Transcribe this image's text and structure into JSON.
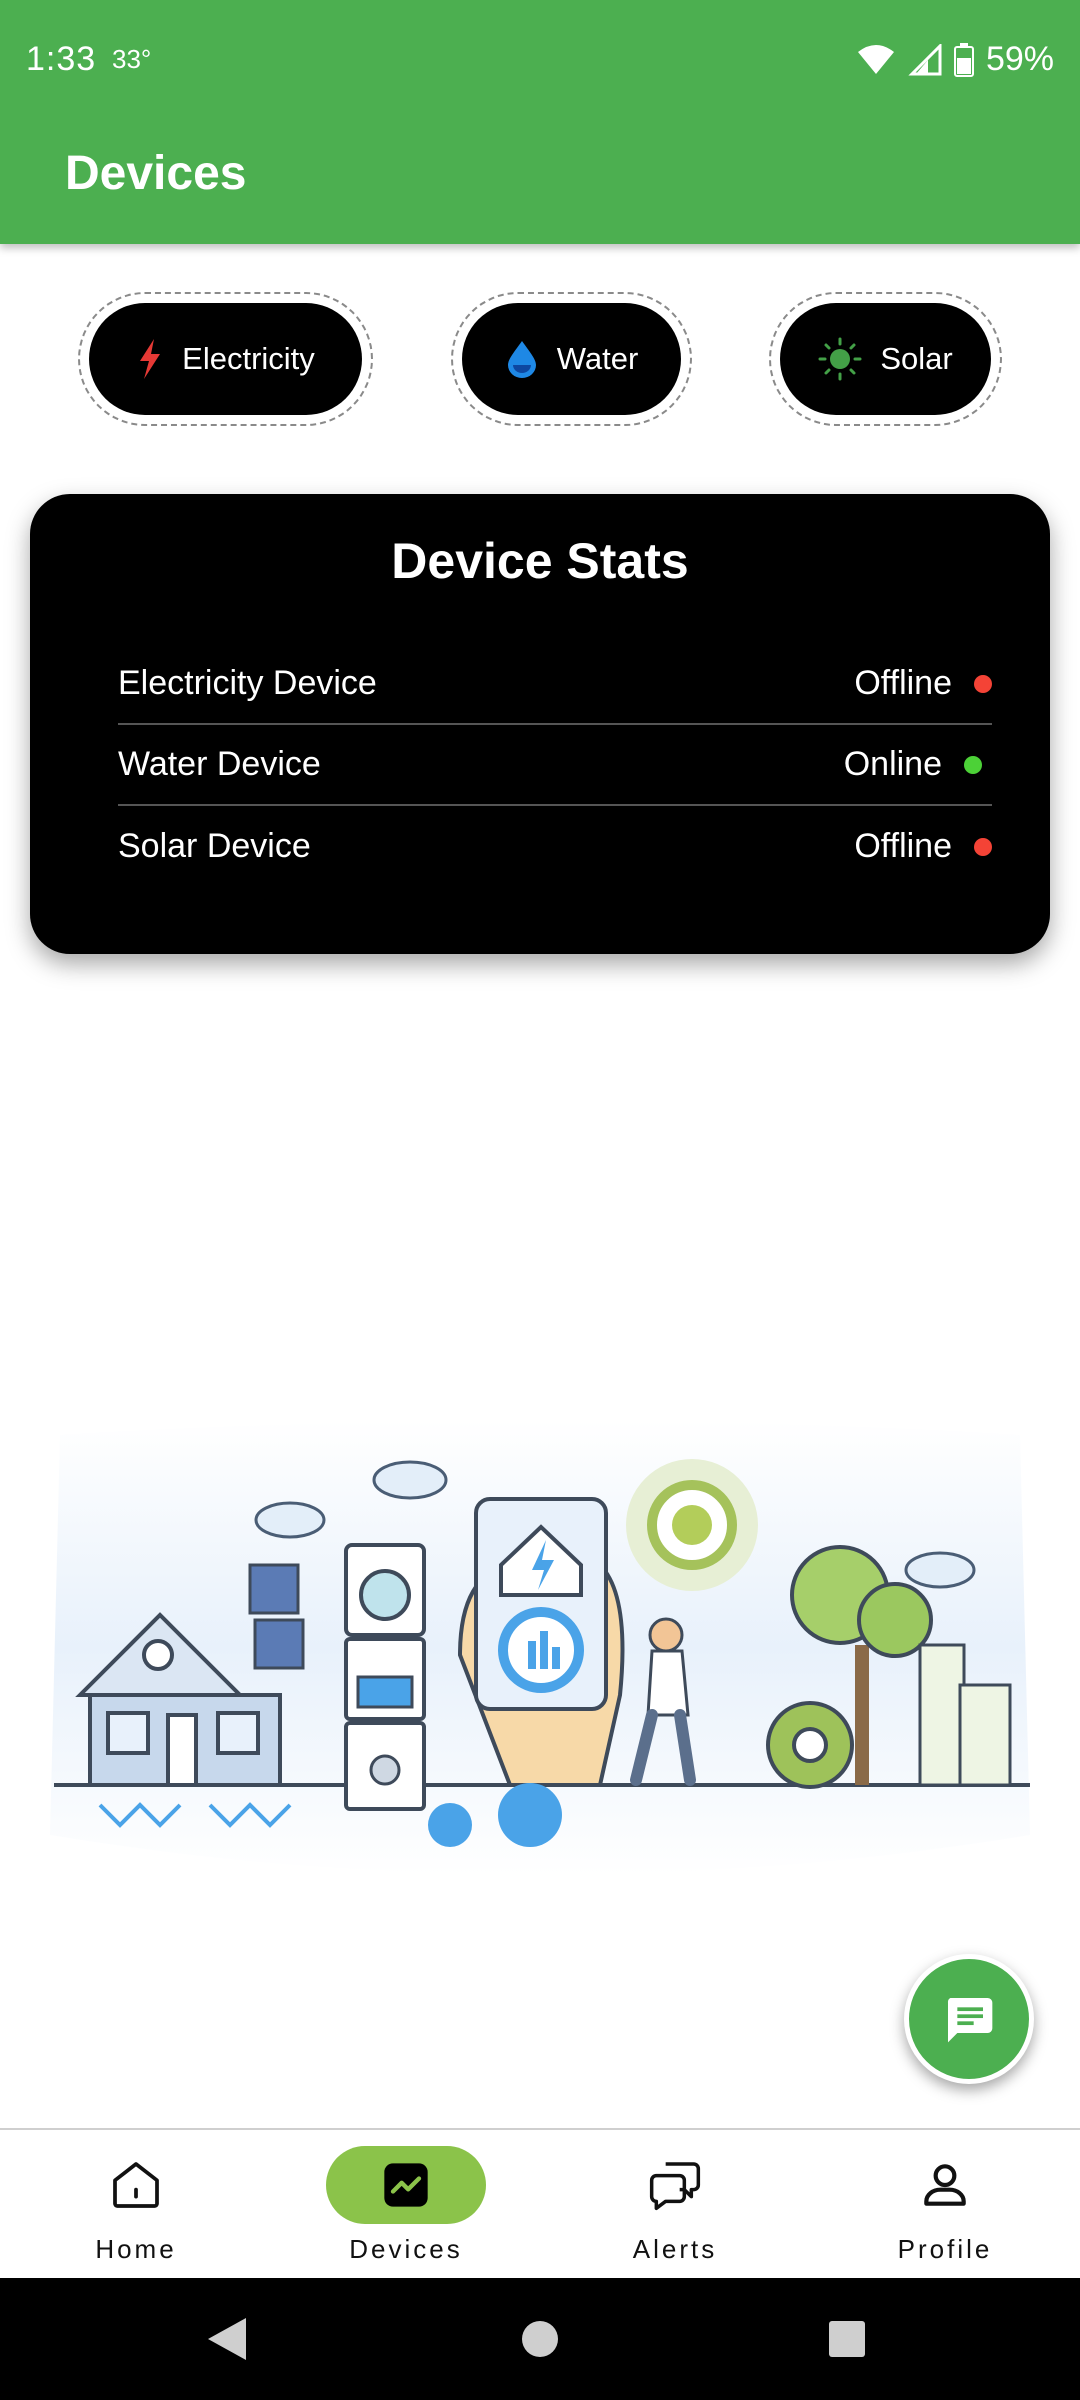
{
  "status": {
    "time": "1:33",
    "temp": "33°",
    "battery": "59%"
  },
  "appbar": {
    "title": "Devices"
  },
  "chips": [
    {
      "label": "Electricity",
      "icon": "bolt-icon",
      "color": "#e53935"
    },
    {
      "label": "Water",
      "icon": "water-drop-icon",
      "color": "#1e88e5"
    },
    {
      "label": "Solar",
      "icon": "sun-icon",
      "color": "#43a047"
    }
  ],
  "stats": {
    "title": "Device Stats",
    "rows": [
      {
        "name": "Electricity Device",
        "status": "Offline",
        "color": "#f44336"
      },
      {
        "name": "Water Device",
        "status": "Online",
        "color": "#4cd137"
      },
      {
        "name": "Solar Device",
        "status": "Offline",
        "color": "#f44336"
      }
    ]
  },
  "fab": {
    "icon": "chat-icon"
  },
  "nav": [
    {
      "label": "Home",
      "icon": "home-icon",
      "active": false
    },
    {
      "label": "Devices",
      "icon": "chart-icon",
      "active": true
    },
    {
      "label": "Alerts",
      "icon": "chat-bubbles-icon",
      "active": false
    },
    {
      "label": "Profile",
      "icon": "person-icon",
      "active": false
    }
  ],
  "colors": {
    "primary": "#4caf50",
    "activePill": "#8bc34a",
    "card": "#000000"
  }
}
